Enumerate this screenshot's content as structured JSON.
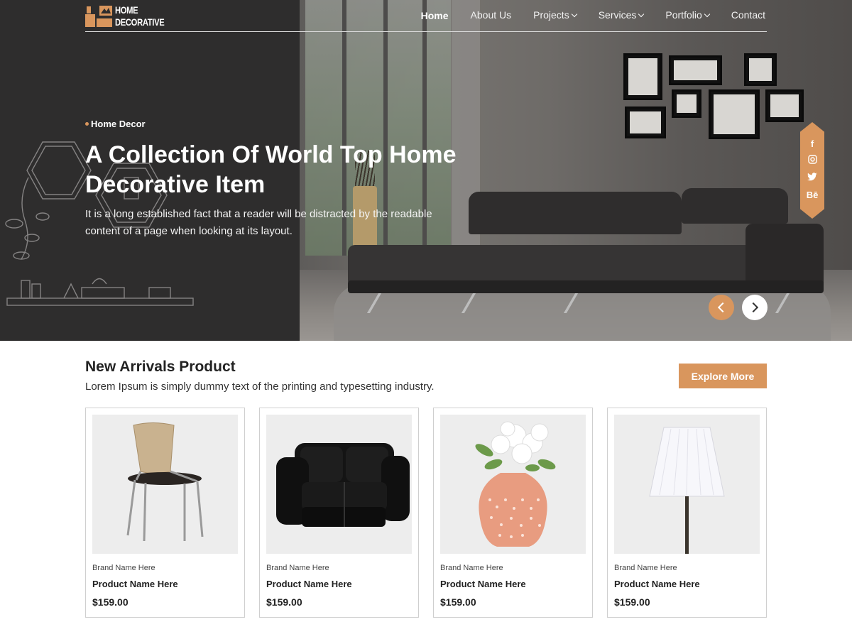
{
  "brand": {
    "line1": "Home",
    "line2": "Decorative"
  },
  "nav": {
    "items": [
      {
        "label": "Home",
        "active": true,
        "dropdown": false
      },
      {
        "label": "About Us",
        "dropdown": false
      },
      {
        "label": "Projects",
        "dropdown": true
      },
      {
        "label": "Services",
        "dropdown": true
      },
      {
        "label": "Portfolio",
        "dropdown": true
      },
      {
        "label": "Contact",
        "dropdown": false
      }
    ]
  },
  "hero": {
    "tag": "Home Decor",
    "title_line1": "A Collection Of World Top Home",
    "title_line2": "Decorative Item",
    "description": "It is a long established fact that a reader will be distracted by the readable content of a page when looking at its layout.",
    "social": [
      {
        "icon": "facebook-icon",
        "glyph": "f"
      },
      {
        "icon": "instagram-icon",
        "glyph": "◎"
      },
      {
        "icon": "twitter-icon",
        "glyph": "🐦"
      },
      {
        "icon": "behance-icon",
        "glyph": "Bē"
      }
    ],
    "prev_icon": "chevron-left-icon",
    "next_icon": "chevron-right-icon"
  },
  "products_section": {
    "title": "New Arrivals Product",
    "subtitle": "Lorem Ipsum is simply dummy text of the printing and typesetting  industry.",
    "explore_label": "Explore More",
    "items": [
      {
        "image": "chair",
        "brand": "Brand Name Here",
        "name": "Product Name Here",
        "price": "$159.00"
      },
      {
        "image": "leather-sofa",
        "brand": "Brand Name Here",
        "name": "Product Name Here",
        "price": "$159.00"
      },
      {
        "image": "flower-vase",
        "brand": "Brand Name Here",
        "name": "Product Name Here",
        "price": "$159.00"
      },
      {
        "image": "floor-lamp",
        "brand": "Brand Name Here",
        "name": "Product Name Here",
        "price": "$159.00"
      }
    ]
  },
  "colors": {
    "accent": "#d9965d",
    "dark": "#2e2d2d",
    "text": "#222222"
  }
}
